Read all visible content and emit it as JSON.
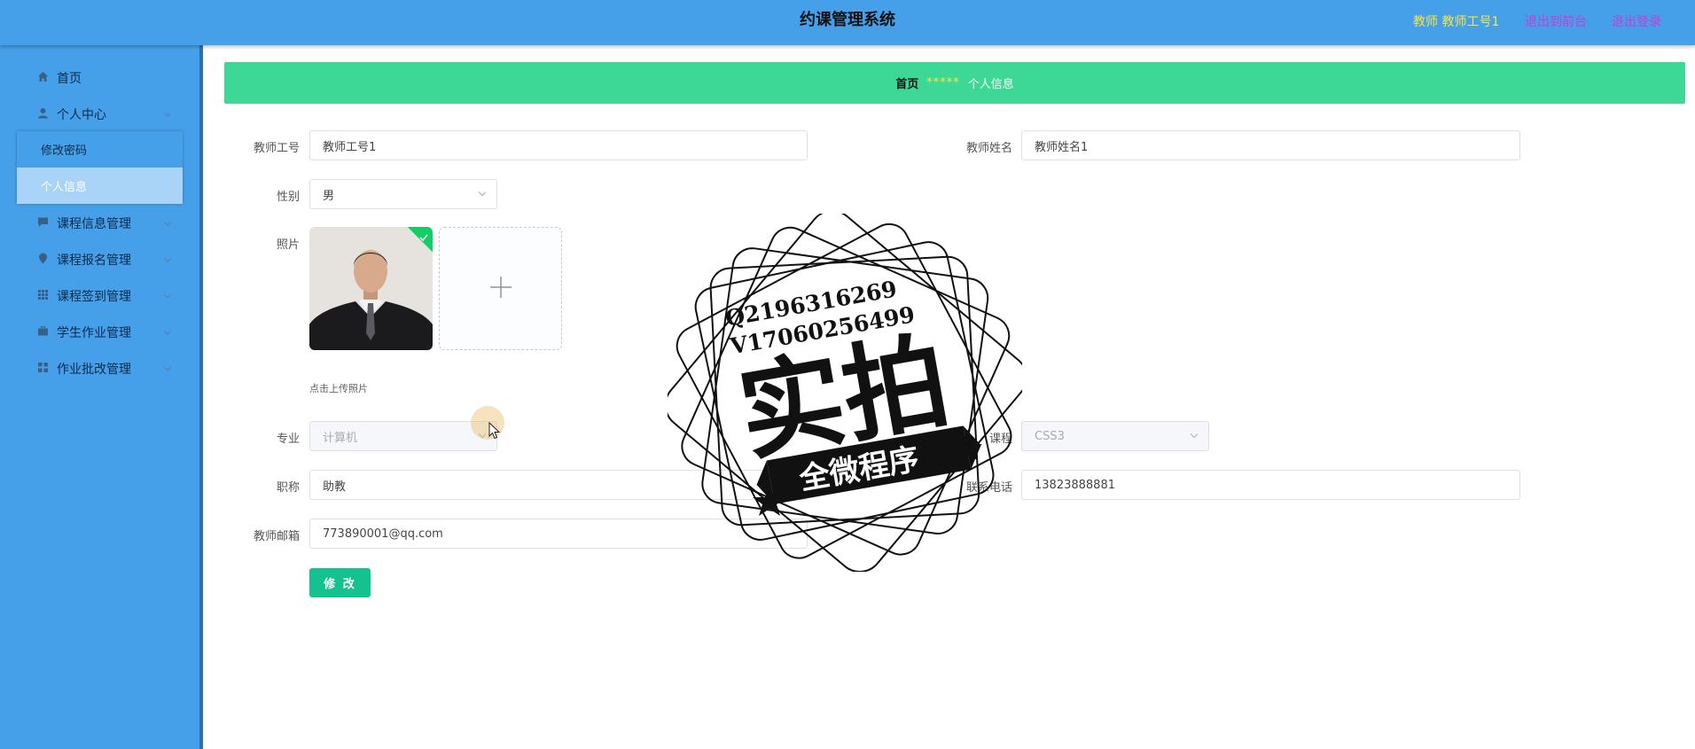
{
  "header": {
    "title": "约课管理系统",
    "user": "教师 教师工号1",
    "link_front": "退出到前台",
    "link_logout": "退出登录"
  },
  "sidebar": {
    "items": [
      {
        "label": "首页",
        "icon": "home-icon"
      },
      {
        "label": "个人中心",
        "icon": "user-icon"
      },
      {
        "label": "课程信息管理",
        "icon": "chat-icon"
      },
      {
        "label": "课程报名管理",
        "icon": "location-icon"
      },
      {
        "label": "课程签到管理",
        "icon": "grid-icon"
      },
      {
        "label": "学生作业管理",
        "icon": "briefcase-icon"
      },
      {
        "label": "作业批改管理",
        "icon": "apps-icon"
      }
    ],
    "submenu": [
      {
        "label": "修改密码"
      },
      {
        "label": "个人信息"
      }
    ]
  },
  "breadcrumb": {
    "home": "首页",
    "separator": "*****",
    "current": "个人信息"
  },
  "form": {
    "teacher_id_label": "教师工号",
    "teacher_id": "教师工号1",
    "teacher_name_label": "教师姓名",
    "teacher_name": "教师姓名1",
    "gender_label": "性别",
    "gender": "男",
    "photo_label": "照片",
    "photo_hint": "点击上传照片",
    "major_label": "专业",
    "major": "计算机",
    "course_label": "课程",
    "course": "CSS3",
    "title_label": "职称",
    "title": "助教",
    "phone_label": "联系电话",
    "phone": "13823888881",
    "email_label": "教师邮箱",
    "email": "773890001@qq.com",
    "submit_label": "修 改"
  },
  "watermark": {
    "line1": "Q2196316269",
    "line2": "V17060256499",
    "big": "实拍",
    "banner": "全微程序"
  },
  "colors": {
    "header_bg": "#46a0e9",
    "breadcrumb_bg": "#3ed896",
    "button_bg": "#13c28e",
    "active_submenu": "#a9d3f7"
  }
}
